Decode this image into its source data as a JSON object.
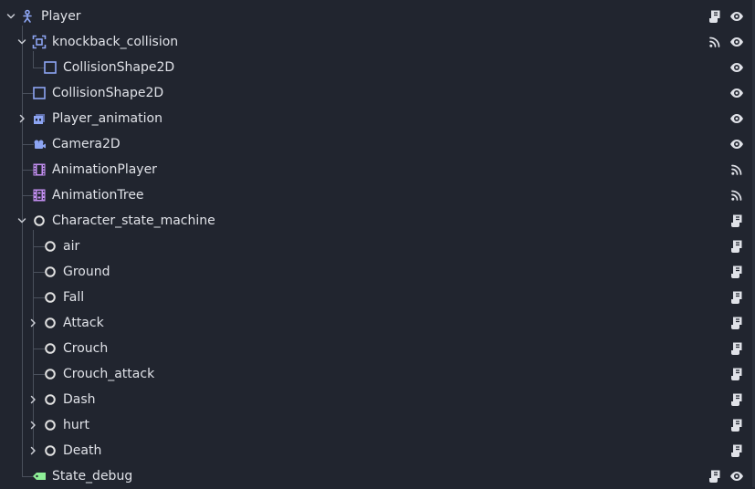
{
  "scene_tree": {
    "nodes": [
      {
        "label": "Player",
        "icon": "character-body-icon",
        "depth": 0,
        "toggle": "expanded",
        "actions": [
          "script-icon",
          "visibility-eye-icon"
        ]
      },
      {
        "label": "knockback_collision",
        "icon": "area2d-icon",
        "depth": 1,
        "toggle": "expanded",
        "actions": [
          "signal-icon",
          "visibility-eye-icon"
        ]
      },
      {
        "label": "CollisionShape2D",
        "icon": "collision-shape-icon",
        "depth": 2,
        "toggle": "none",
        "actions": [
          "visibility-eye-icon"
        ]
      },
      {
        "label": "CollisionShape2D",
        "icon": "collision-shape-icon",
        "depth": 1,
        "toggle": "none",
        "actions": [
          "visibility-eye-icon"
        ]
      },
      {
        "label": "Player_animation",
        "icon": "animated-sprite-icon",
        "depth": 1,
        "toggle": "collapsed",
        "actions": [
          "visibility-eye-icon"
        ]
      },
      {
        "label": "Camera2D",
        "icon": "camera-icon",
        "depth": 1,
        "toggle": "none",
        "actions": [
          "visibility-eye-icon"
        ]
      },
      {
        "label": "AnimationPlayer",
        "icon": "animation-player-icon",
        "depth": 1,
        "toggle": "none",
        "actions": [
          "signal-icon"
        ]
      },
      {
        "label": "AnimationTree",
        "icon": "animation-tree-icon",
        "depth": 1,
        "toggle": "none",
        "actions": [
          "signal-icon"
        ]
      },
      {
        "label": "Character_state_machine",
        "icon": "node-circle-icon",
        "depth": 1,
        "toggle": "expanded",
        "actions": [
          "script-icon"
        ]
      },
      {
        "label": "air",
        "icon": "node-circle-icon",
        "depth": 2,
        "toggle": "none",
        "actions": [
          "script-icon"
        ]
      },
      {
        "label": "Ground",
        "icon": "node-circle-icon",
        "depth": 2,
        "toggle": "none",
        "actions": [
          "script-icon"
        ]
      },
      {
        "label": "Fall",
        "icon": "node-circle-icon",
        "depth": 2,
        "toggle": "none",
        "actions": [
          "script-icon"
        ]
      },
      {
        "label": "Attack",
        "icon": "node-circle-icon",
        "depth": 2,
        "toggle": "collapsed",
        "actions": [
          "script-icon"
        ]
      },
      {
        "label": "Crouch",
        "icon": "node-circle-icon",
        "depth": 2,
        "toggle": "none",
        "actions": [
          "script-icon"
        ]
      },
      {
        "label": "Crouch_attack",
        "icon": "node-circle-icon",
        "depth": 2,
        "toggle": "none",
        "actions": [
          "script-icon"
        ]
      },
      {
        "label": "Dash",
        "icon": "node-circle-icon",
        "depth": 2,
        "toggle": "collapsed",
        "actions": [
          "script-icon"
        ]
      },
      {
        "label": "hurt",
        "icon": "node-circle-icon",
        "depth": 2,
        "toggle": "collapsed",
        "actions": [
          "script-icon"
        ]
      },
      {
        "label": "Death",
        "icon": "node-circle-icon",
        "depth": 2,
        "toggle": "collapsed",
        "actions": [
          "script-icon"
        ]
      },
      {
        "label": "State_debug",
        "icon": "label-tag-icon",
        "depth": 1,
        "toggle": "none",
        "actions": [
          "script-icon",
          "visibility-eye-icon"
        ]
      }
    ]
  },
  "colors": {
    "background": "#21252f",
    "text": "#e0e2e8",
    "icon_2d": "#8da5f3",
    "icon_animation": "#c38ef1",
    "icon_control": "#8eef97",
    "icon_node": "#e0e0e0",
    "guide_line": "#4a505c"
  }
}
